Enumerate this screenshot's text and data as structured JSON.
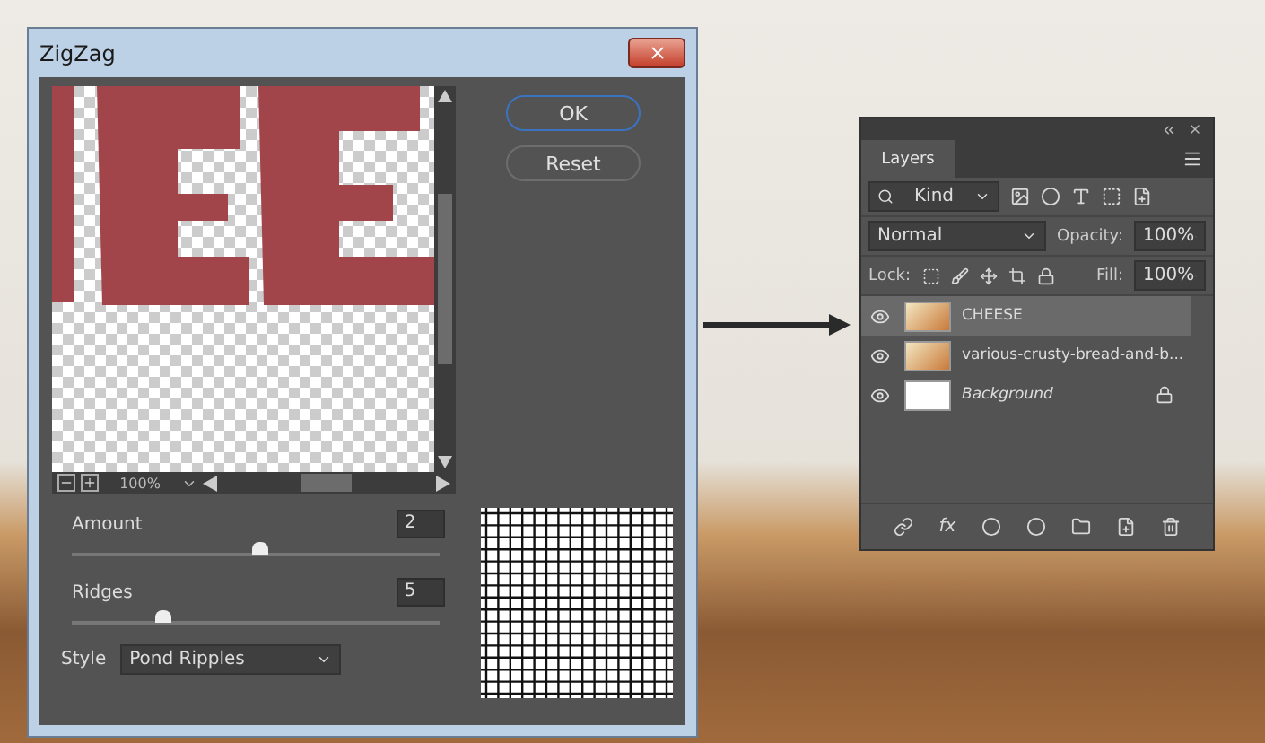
{
  "dialog": {
    "title": "ZigZag",
    "zoom": "100%",
    "buttons": [
      {
        "label": "OK",
        "selected": true
      },
      {
        "label": "Reset",
        "selected": false
      }
    ],
    "sliders": [
      {
        "label": "Amount",
        "value": "2",
        "level": 0.51
      },
      {
        "label": "Ridges",
        "value": "5",
        "level": 0.25
      }
    ],
    "style": {
      "label": "Style",
      "value": "Pond Ripples"
    }
  },
  "layers_panel": {
    "title": "Layers",
    "effects_label": "fx",
    "filter": "Kind",
    "blend_mode": "Normal",
    "opacity_label": "Opacity:",
    "opacity": "100%",
    "lock_label": "Lock:",
    "fill_label": "Fill:",
    "fill": "100%",
    "layers": [
      {
        "name": "CHEESE",
        "kind": "smart",
        "selected": true,
        "visible": true,
        "locked": false
      },
      {
        "name": "various-crusty-bread-and-b...",
        "kind": "smart",
        "selected": false,
        "visible": true,
        "locked": false
      },
      {
        "name": "Background",
        "kind": "background",
        "selected": false,
        "visible": true,
        "locked": true
      }
    ]
  }
}
